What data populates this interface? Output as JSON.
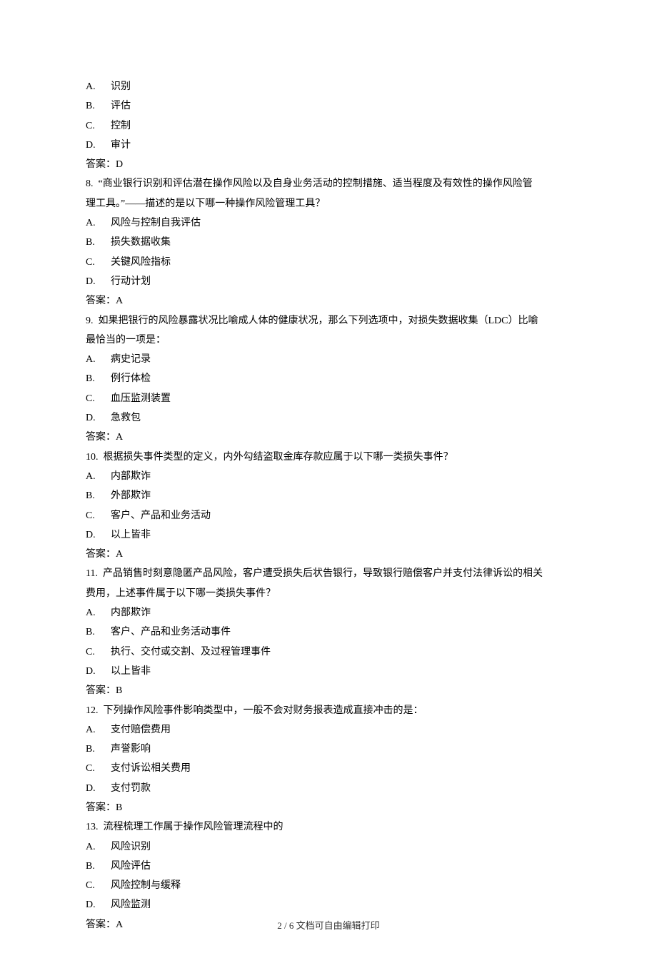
{
  "q7": {
    "options": [
      {
        "letter": "A.",
        "text": "识别"
      },
      {
        "letter": "B.",
        "text": "评估"
      },
      {
        "letter": "C.",
        "text": "控制"
      },
      {
        "letter": "D.",
        "text": "审计"
      }
    ],
    "answer_label": "答案：D"
  },
  "q8": {
    "number": "8.",
    "stem_a": "“商业银行识别和评估潜在操作风险以及自身业务活动的控制措施、适当程度及有效性的操作风险管",
    "stem_b": "理工具。”——描述的是以下哪一种操作风险管理工具？",
    "options": [
      {
        "letter": "A.",
        "text": "风险与控制自我评估"
      },
      {
        "letter": "B.",
        "text": "损失数据收集"
      },
      {
        "letter": "C.",
        "text": "关键风险指标"
      },
      {
        "letter": "D.",
        "text": "行动计划"
      }
    ],
    "answer_label": "答案：A"
  },
  "q9": {
    "number": "9.",
    "stem_a": "如果把银行的风险暴露状况比喻成人体的健康状况，那么下列选项中，对损失数据收集（LDC）比喻",
    "stem_b": "最恰当的一项是：",
    "options": [
      {
        "letter": "A.",
        "text": "病史记录"
      },
      {
        "letter": "B.",
        "text": "例行体检"
      },
      {
        "letter": "C.",
        "text": "血压监测装置"
      },
      {
        "letter": "D.",
        "text": "急救包"
      }
    ],
    "answer_label": "答案：A"
  },
  "q10": {
    "number": "10.",
    "stem": "根据损失事件类型的定义，内外勾结盗取金库存款应属于以下哪一类损失事件？",
    "options": [
      {
        "letter": "A.",
        "text": "内部欺诈"
      },
      {
        "letter": "B.",
        "text": "外部欺诈"
      },
      {
        "letter": "C.",
        "text": "客户、产品和业务活动"
      },
      {
        "letter": "D.",
        "text": "以上皆非"
      }
    ],
    "answer_label": "答案：A"
  },
  "q11": {
    "number": "11.",
    "stem_a": "产品销售时刻意隐匿产品风险，客户遭受损失后状告银行，导致银行赔偿客户并支付法律诉讼的相关",
    "stem_b": "费用，上述事件属于以下哪一类损失事件？",
    "options": [
      {
        "letter": "A.",
        "text": "内部欺诈"
      },
      {
        "letter": "B.",
        "text": "客户、产品和业务活动事件"
      },
      {
        "letter": "C.",
        "text": "执行、交付或交割、及过程管理事件"
      },
      {
        "letter": "D.",
        "text": "以上皆非"
      }
    ],
    "answer_label": "答案：B"
  },
  "q12": {
    "number": "12.",
    "stem": "下列操作风险事件影响类型中，一般不会对财务报表造成直接冲击的是：",
    "options": [
      {
        "letter": "A.",
        "text": "支付赔偿费用"
      },
      {
        "letter": "B.",
        "text": "声誉影响"
      },
      {
        "letter": "C.",
        "text": "支付诉讼相关费用"
      },
      {
        "letter": "D.",
        "text": "支付罚款"
      }
    ],
    "answer_label": "答案：B"
  },
  "q13": {
    "number": "13.",
    "stem": "流程梳理工作属于操作风险管理流程中的",
    "options": [
      {
        "letter": "A.",
        "text": "风险识别"
      },
      {
        "letter": "B.",
        "text": "风险评估"
      },
      {
        "letter": "C.",
        "text": "风险控制与缓释"
      },
      {
        "letter": "D.",
        "text": "风险监测"
      }
    ],
    "answer_label": "答案：A"
  },
  "footer": {
    "page": "2 / 6",
    "note": "文档可自由编辑打印"
  }
}
